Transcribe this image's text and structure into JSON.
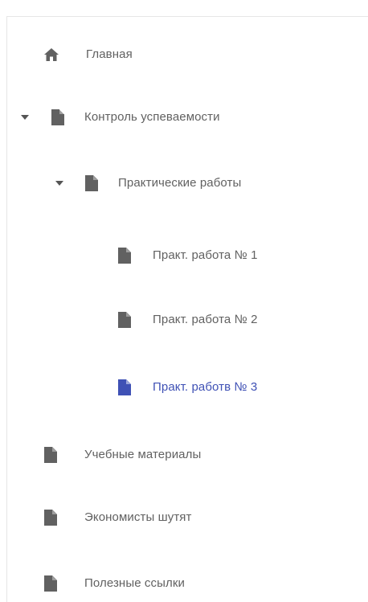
{
  "nav": {
    "items": [
      {
        "label": "Главная",
        "icon": "home-icon",
        "expanded": null,
        "active": false,
        "level": 0
      },
      {
        "label": "Контроль успеваемости",
        "icon": "document-icon",
        "expanded": true,
        "active": false,
        "level": 0
      },
      {
        "label": "Практические работы",
        "icon": "document-icon",
        "expanded": true,
        "active": false,
        "level": 1
      },
      {
        "label": "Практ. работа № 1",
        "icon": "document-icon",
        "expanded": null,
        "active": false,
        "level": 2
      },
      {
        "label": "Практ. работа № 2",
        "icon": "document-icon",
        "expanded": null,
        "active": false,
        "level": 2
      },
      {
        "label": "Практ. работв № 3",
        "icon": "document-icon",
        "expanded": null,
        "active": true,
        "level": 2
      },
      {
        "label": "Учебные материалы",
        "icon": "document-icon",
        "expanded": null,
        "active": false,
        "level": 0
      },
      {
        "label": "Экономисты шутят",
        "icon": "document-icon",
        "expanded": null,
        "active": false,
        "level": 0
      },
      {
        "label": "Полезные ссылки",
        "icon": "document-icon",
        "expanded": null,
        "active": false,
        "level": 0
      }
    ]
  },
  "colors": {
    "text": "#616161",
    "icon": "#616161",
    "active": "#3f51b5",
    "caret": "#555555"
  }
}
